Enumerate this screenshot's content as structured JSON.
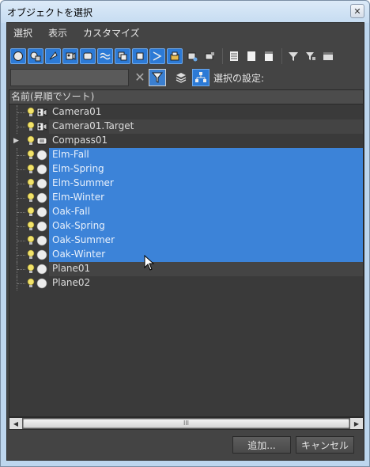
{
  "window": {
    "title": "オブジェクトを選択",
    "close_label": "✕"
  },
  "menu": [
    "選択",
    "表示",
    "カスタマイズ"
  ],
  "search": {
    "value": "",
    "placeholder": ""
  },
  "toolbar2": {
    "clear_icon": "✕",
    "settings_label": "選択の設定:"
  },
  "list": {
    "header": "名前(昇順でソート)",
    "rows": [
      {
        "label": "Camera01",
        "icon": "camera-icon",
        "selected": false,
        "expander": false
      },
      {
        "label": "Camera01.Target",
        "icon": "camera-icon",
        "selected": false,
        "expander": false
      },
      {
        "label": "Compass01",
        "icon": "helper-icon",
        "selected": false,
        "expander": true
      },
      {
        "label": "Elm-Fall",
        "icon": "sphere-icon",
        "selected": true,
        "expander": false
      },
      {
        "label": "Elm-Spring",
        "icon": "sphere-icon",
        "selected": true,
        "expander": false
      },
      {
        "label": "Elm-Summer",
        "icon": "sphere-icon",
        "selected": true,
        "expander": false
      },
      {
        "label": "Elm-Winter",
        "icon": "sphere-icon",
        "selected": true,
        "expander": false
      },
      {
        "label": "Oak-Fall",
        "icon": "sphere-icon",
        "selected": true,
        "expander": false
      },
      {
        "label": "Oak-Spring",
        "icon": "sphere-icon",
        "selected": true,
        "expander": false
      },
      {
        "label": "Oak-Summer",
        "icon": "sphere-icon",
        "selected": true,
        "expander": false
      },
      {
        "label": "Oak-Winter",
        "icon": "sphere-icon",
        "selected": true,
        "expander": false
      },
      {
        "label": "Plane01",
        "icon": "sphere-icon",
        "selected": false,
        "expander": false
      },
      {
        "label": "Plane02",
        "icon": "sphere-icon",
        "selected": false,
        "expander": false
      }
    ]
  },
  "scrollbar": {
    "thumb_grip": "III"
  },
  "buttons": {
    "add": "追加...",
    "cancel": "キャンセル"
  },
  "colors": {
    "selection": "#3c83d8",
    "panel": "#444444",
    "toolbar_active": "#2c7ad6"
  }
}
